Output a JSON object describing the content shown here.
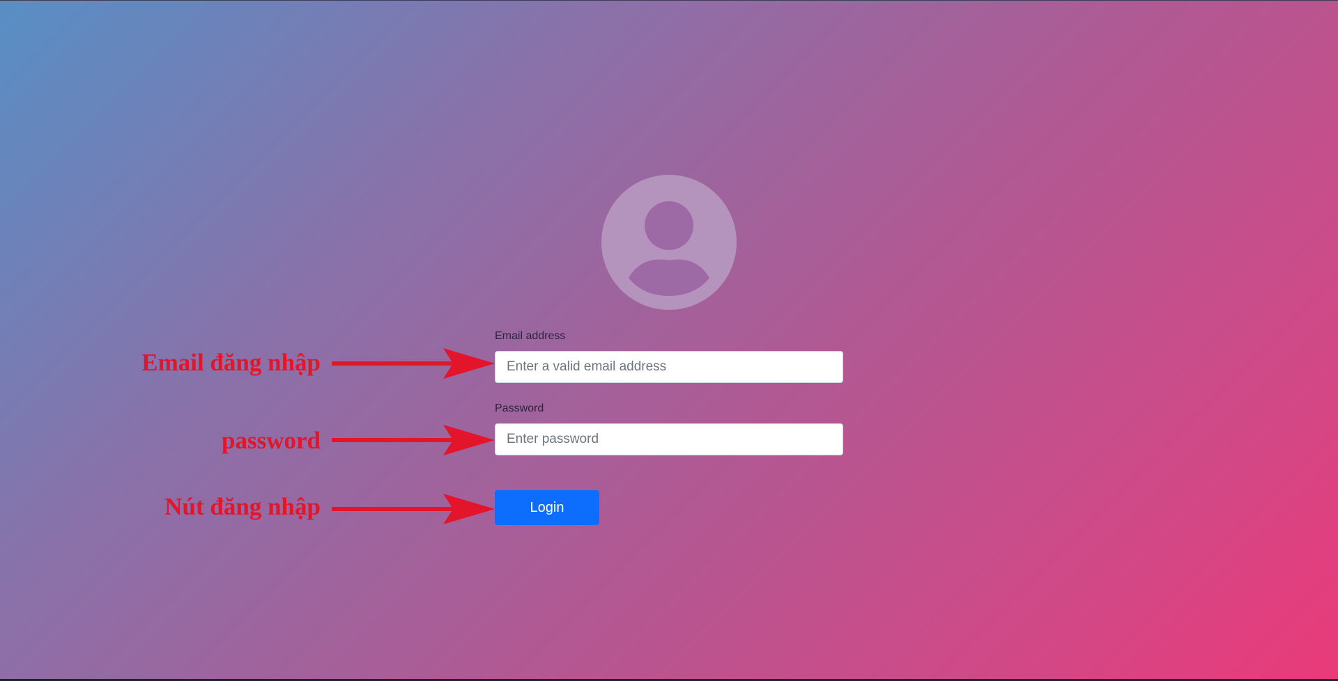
{
  "login_form": {
    "email_label": "Email address",
    "email_placeholder": "Enter a valid email address",
    "email_value": "",
    "password_label": "Password",
    "password_placeholder": "Enter password",
    "password_value": "",
    "login_button_label": "Login"
  },
  "annotations": {
    "email": "Email đăng nhập",
    "password": "password",
    "login": "Nút đăng nhập"
  },
  "icons": {
    "avatar": "user-avatar-icon",
    "arrow": "arrow-right-icon"
  },
  "colors": {
    "gradient_start": "#578fc5",
    "gradient_end": "#ea3a79",
    "button": "#0d6efd",
    "annotation": "#e3152a"
  }
}
